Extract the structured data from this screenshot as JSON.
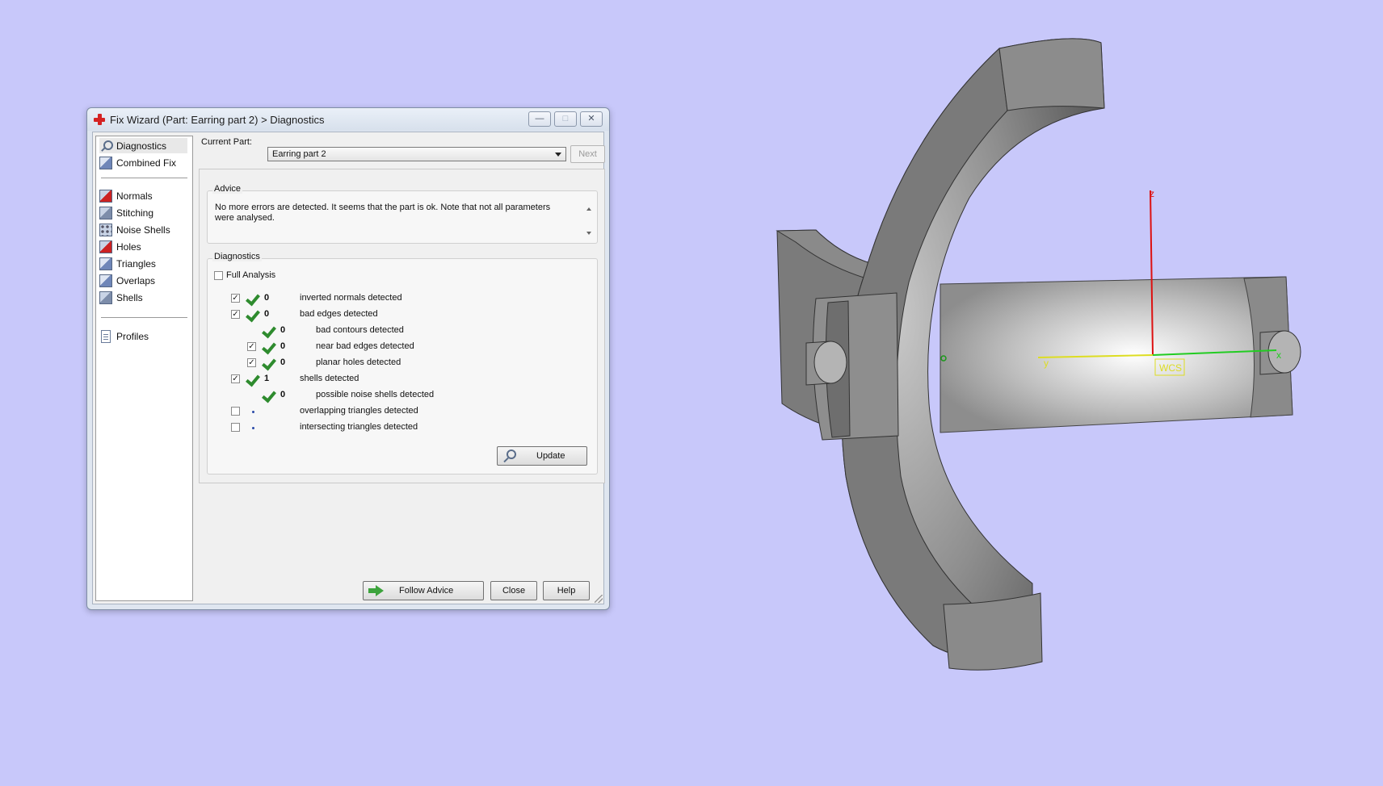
{
  "window": {
    "title": "Fix Wizard (Part: Earring part 2) > Diagnostics",
    "buttons": {
      "minimize": "—",
      "maximize": "□",
      "close": "✕"
    }
  },
  "nav": {
    "items": [
      {
        "label": "Diagnostics",
        "icon": "magnifier-icon",
        "selected": true
      },
      {
        "label": "Combined Fix",
        "icon": "cube-icon"
      },
      {
        "label": "Normals",
        "icon": "cube-icon"
      },
      {
        "label": "Stitching",
        "icon": "cube-icon"
      },
      {
        "label": "Noise Shells",
        "icon": "cube-icon"
      },
      {
        "label": "Holes",
        "icon": "cube-icon"
      },
      {
        "label": "Triangles",
        "icon": "cube-icon"
      },
      {
        "label": "Overlaps",
        "icon": "cube-icon"
      },
      {
        "label": "Shells",
        "icon": "cube-icon"
      },
      {
        "label": "Profiles",
        "icon": "document-icon"
      }
    ]
  },
  "current_part": {
    "label": "Current Part:",
    "value": "Earring part 2"
  },
  "next_label": "Next",
  "advice": {
    "title": "Advice",
    "text": "No more errors are detected. It seems that the part is ok. Note that not all parameters were analysed."
  },
  "diagnostics": {
    "title": "Diagnostics",
    "full_analysis_label": "Full Analysis",
    "full_analysis_checked": false,
    "rows": [
      {
        "checked": true,
        "status": "ok",
        "count": "0",
        "text": "inverted normals detected",
        "indent": 0
      },
      {
        "checked": true,
        "status": "ok",
        "count": "0",
        "text": "bad edges detected",
        "indent": 0
      },
      {
        "checked": null,
        "status": "ok",
        "count": "0",
        "text": "bad contours detected",
        "indent": 1
      },
      {
        "checked": true,
        "status": "ok",
        "count": "0",
        "text": "near bad edges detected",
        "indent": 1
      },
      {
        "checked": true,
        "status": "ok",
        "count": "0",
        "text": "planar holes detected",
        "indent": 1
      },
      {
        "checked": true,
        "status": "ok",
        "count": "1",
        "text": "shells detected",
        "indent": 0
      },
      {
        "checked": null,
        "status": "ok",
        "count": "0",
        "text": "possible noise shells detected",
        "indent": 1
      },
      {
        "checked": false,
        "status": "pending",
        "count": "",
        "text": "overlapping triangles detected",
        "indent": 0
      },
      {
        "checked": false,
        "status": "pending",
        "count": "",
        "text": "intersecting triangles detected",
        "indent": 0
      }
    ],
    "update_label": "Update"
  },
  "footer": {
    "follow_advice": "Follow Advice",
    "close": "Close",
    "help": "Help"
  },
  "viewport": {
    "axes": {
      "x": "x",
      "y": "y",
      "z": "z",
      "origin_label": "WCS"
    },
    "colors": {
      "x_axis": "#22cc22",
      "y_axis": "#dddd22",
      "z_axis": "#dd1111",
      "background": "#c8c8fa",
      "model": "#7a7a7a"
    }
  }
}
